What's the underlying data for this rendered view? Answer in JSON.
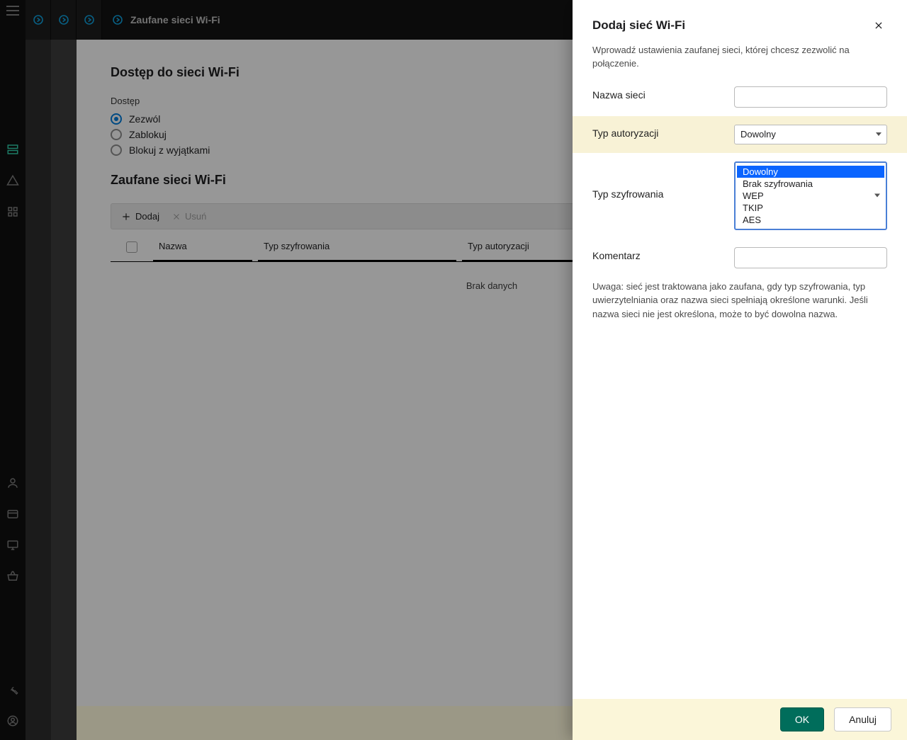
{
  "header": {
    "crumb_title": "Zaufane sieci Wi-Fi"
  },
  "page": {
    "heading_access": "Dostęp do sieci Wi-Fi",
    "access_label": "Dostęp",
    "radios": {
      "allow": "Zezwól",
      "block": "Zablokuj",
      "except": "Blokuj z wyjątkami"
    },
    "heading_trusted": "Zaufane sieci Wi-Fi",
    "toolbar": {
      "add": "Dodaj",
      "del": "Usuń"
    },
    "cols": {
      "name": "Nazwa",
      "enc": "Typ szyfrowania",
      "auth": "Typ autoryzacji"
    },
    "no_data": "Brak danych"
  },
  "dialog": {
    "title": "Dodaj sieć Wi-Fi",
    "help": "Wprowadź ustawienia zaufanej sieci, której chcesz zezwolić na połączenie.",
    "labels": {
      "name": "Nazwa sieci",
      "auth": "Typ autoryzacji",
      "enc": "Typ szyfrowania",
      "comment": "Komentarz"
    },
    "auth_value": "Dowolny",
    "enc_options": [
      "Dowolny",
      "Brak szyfrowania",
      "WEP",
      "TKIP",
      "AES"
    ],
    "enc_selected_index": 0,
    "note": "Uwaga: sieć jest traktowana jako zaufana, gdy typ szyfrowania, typ uwierzytelniania oraz nazwa sieci spełniają określone warunki. Jeśli nazwa sieci nie jest określona, może to być dowolna nazwa.",
    "ok": "OK",
    "cancel": "Anuluj"
  }
}
